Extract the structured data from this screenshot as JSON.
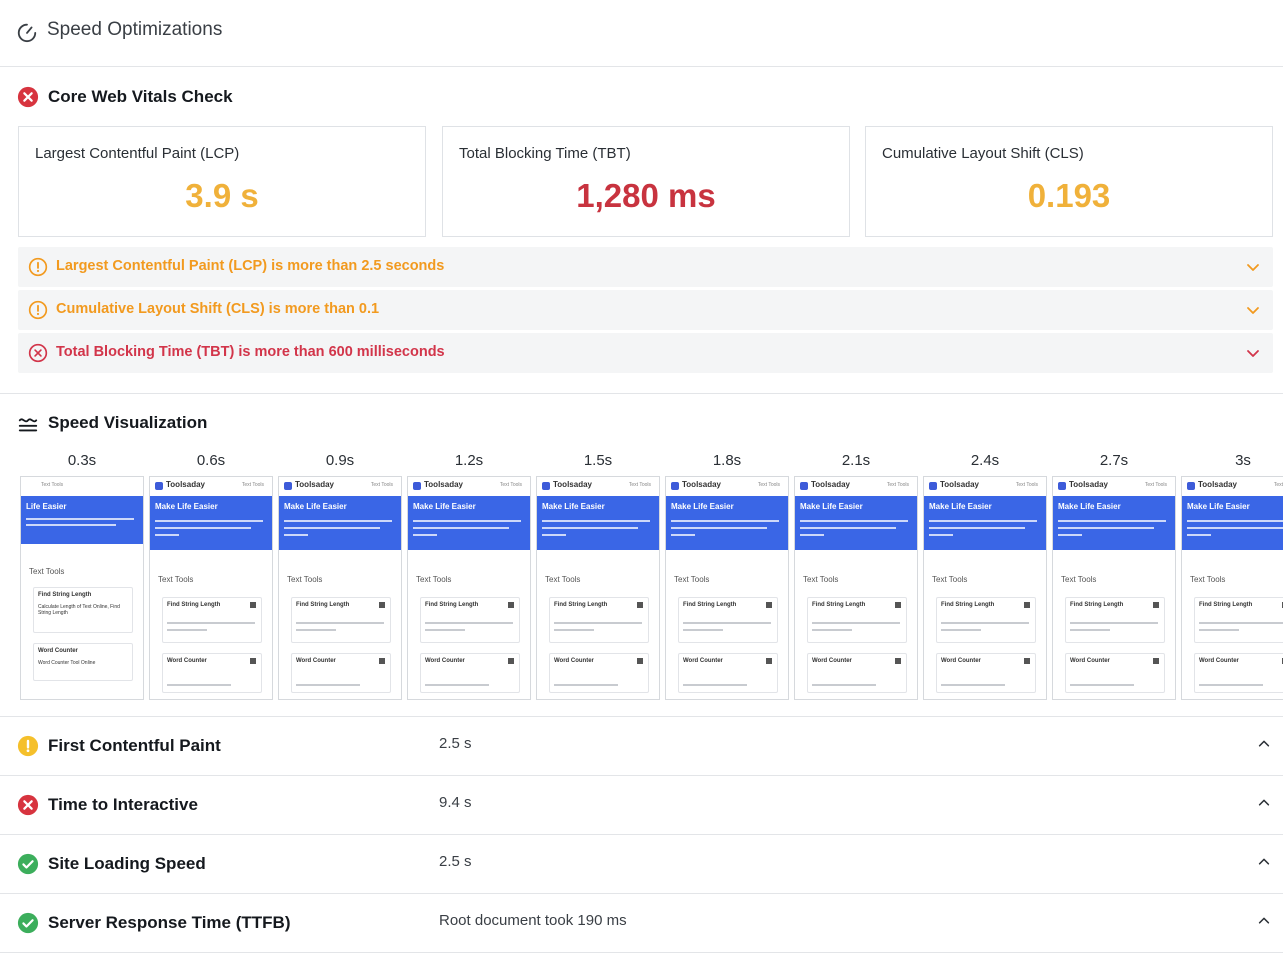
{
  "header": {
    "title": "Speed Optimizations",
    "icon": "speedometer-icon"
  },
  "cwv": {
    "title": "Core Web Vitals Check",
    "status": "fail",
    "metrics": [
      {
        "label": "Largest Contentful Paint (LCP)",
        "value": "3.9 s",
        "color": "#f0b13a"
      },
      {
        "label": "Total Blocking Time (TBT)",
        "value": "1,280 ms",
        "color": "#c8333f"
      },
      {
        "label": "Cumulative Layout Shift (CLS)",
        "value": "0.193",
        "color": "#f0b13a"
      }
    ],
    "warnings": [
      {
        "text": "Largest Contentful Paint (LCP) is more than 2.5 seconds",
        "level": "warning",
        "color": "#f29a1f",
        "icon": "exclamation-circle-icon"
      },
      {
        "text": "Cumulative Layout Shift (CLS) is more than 0.1",
        "level": "warning",
        "color": "#f29a1f",
        "icon": "exclamation-circle-icon"
      },
      {
        "text": "Total Blocking Time (TBT) is more than 600 milliseconds",
        "level": "error",
        "color": "#d2354a",
        "icon": "x-circle-icon"
      }
    ]
  },
  "visualization": {
    "title": "Speed Visualization",
    "icon": "waveform-icon",
    "frames": [
      {
        "time": "0.3s",
        "variant": "early"
      },
      {
        "time": "0.6s",
        "variant": "loaded"
      },
      {
        "time": "0.9s",
        "variant": "loaded"
      },
      {
        "time": "1.2s",
        "variant": "loaded"
      },
      {
        "time": "1.5s",
        "variant": "loaded"
      },
      {
        "time": "1.8s",
        "variant": "loaded"
      },
      {
        "time": "2.1s",
        "variant": "loaded"
      },
      {
        "time": "2.4s",
        "variant": "loaded"
      },
      {
        "time": "2.7s",
        "variant": "loaded"
      },
      {
        "time": "3s",
        "variant": "loaded"
      }
    ],
    "shot": {
      "brand": "Toolsaday",
      "nav": "Text Tools",
      "hero_title": "Make Life Easier",
      "hero_title_early": "Life Easier",
      "section": "Text Tools",
      "card1": "Find String Length",
      "card2": "Word Counter",
      "card1_desc_early": "Calculate Length of Text Online, Find String Length",
      "card2_desc_early": "Word Counter Tool Online"
    }
  },
  "audits": [
    {
      "label": "First Contentful Paint",
      "value": "2.5 s",
      "status": "warning",
      "color": "#f5c02b",
      "icon": "exclamation-circle-icon"
    },
    {
      "label": "Time to Interactive",
      "value": "9.4 s",
      "status": "fail",
      "color": "#d7343f",
      "icon": "x-circle-icon"
    },
    {
      "label": "Site Loading Speed",
      "value": "2.5 s",
      "status": "pass",
      "color": "#3cae5c",
      "icon": "check-circle-icon"
    },
    {
      "label": "Server Response Time (TTFB)",
      "value": "Root document took 190 ms",
      "status": "pass",
      "color": "#3cae5c",
      "icon": "check-circle-icon"
    }
  ]
}
